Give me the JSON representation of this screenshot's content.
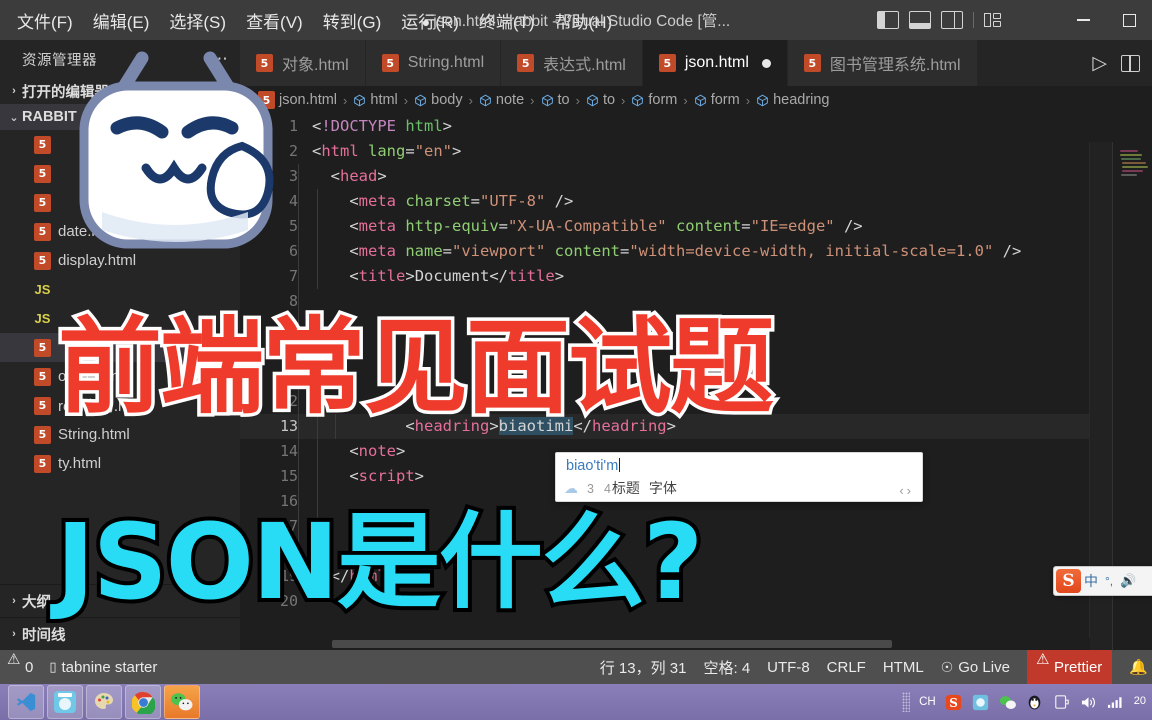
{
  "window": {
    "title": "json.html - rabbit - Visual Studio Code [管...",
    "dirty_dot": "●",
    "menu": [
      "文件(F)",
      "编辑(E)",
      "选择(S)",
      "查看(V)",
      "转到(G)",
      "运行(R)",
      "终端(T)",
      "帮助(H)"
    ],
    "controls": {
      "minimize": "—",
      "maximize": "▢"
    }
  },
  "sidebar": {
    "title": "资源管理器",
    "overflow": "⋯",
    "sections": [
      {
        "label": "打开的编辑器",
        "chevron": "›"
      },
      {
        "label": "RABBIT",
        "chevron": "⌄"
      }
    ],
    "files": [
      {
        "name": "",
        "icon": "html5-icon"
      },
      {
        "name": "",
        "icon": "html5-icon"
      },
      {
        "name": "",
        "icon": "html5-icon"
      },
      {
        "name": "date.html",
        "icon": "html5-icon"
      },
      {
        "name": "display.html",
        "icon": "html5-icon"
      },
      {
        "name": "",
        "icon": "js-icon"
      },
      {
        "name": "",
        "icon": "js-icon"
      },
      {
        "name": "",
        "icon": "html5-icon"
      },
      {
        "name": "oject.html",
        "icon": "html5-icon"
      },
      {
        "name": "rem布局.html",
        "icon": "html5-icon"
      },
      {
        "name": "String.html",
        "icon": "html5-icon"
      },
      {
        "name": "ty.html",
        "icon": "html5-icon"
      }
    ],
    "bottom": [
      {
        "label": "大纲",
        "chevron": "›"
      },
      {
        "label": "时间线",
        "chevron": "›"
      }
    ]
  },
  "tabs": [
    {
      "label": "对象.html",
      "icon": "html5-icon",
      "active": false,
      "dirty": false
    },
    {
      "label": "String.html",
      "icon": "html5-icon",
      "active": false,
      "dirty": false
    },
    {
      "label": "表达式.html",
      "icon": "html5-icon",
      "active": false,
      "dirty": false
    },
    {
      "label": "json.html",
      "icon": "html5-icon",
      "active": true,
      "dirty": true
    },
    {
      "label": "图书管理系统.html",
      "icon": "html5-icon",
      "active": false,
      "dirty": false
    }
  ],
  "tab_actions": {
    "run": "▷",
    "split": "split-editor-icon"
  },
  "breadcrumb": [
    "json.html",
    "html",
    "body",
    "note",
    "to",
    "to",
    "form",
    "form",
    "headring"
  ],
  "code": {
    "lines": [
      {
        "num": "1",
        "indent": 0,
        "current": false,
        "tokens": [
          {
            "t": "punc",
            "v": "<"
          },
          {
            "t": "doct",
            "v": "!DOCTYPE "
          },
          {
            "t": "tagn",
            "v": "html"
          },
          {
            "t": "punc",
            "v": ">"
          }
        ]
      },
      {
        "num": "2",
        "indent": 0,
        "current": false,
        "tokens": [
          {
            "t": "punc",
            "v": "<"
          },
          {
            "t": "tag",
            "v": "html"
          },
          {
            "t": "attrn",
            "v": " lang"
          },
          {
            "t": "punc",
            "v": "="
          },
          {
            "t": "str",
            "v": "\"en\""
          },
          {
            "t": "punc",
            "v": ">"
          }
        ]
      },
      {
        "num": "3",
        "indent": 1,
        "current": false,
        "tokens": [
          {
            "t": "punc",
            "v": "  <"
          },
          {
            "t": "tag",
            "v": "head"
          },
          {
            "t": "punc",
            "v": ">"
          }
        ]
      },
      {
        "num": "4",
        "indent": 2,
        "current": false,
        "tokens": [
          {
            "t": "punc",
            "v": "    <"
          },
          {
            "t": "tag",
            "v": "meta"
          },
          {
            "t": "attrn",
            "v": " charset"
          },
          {
            "t": "punc",
            "v": "="
          },
          {
            "t": "str",
            "v": "\"UTF-8\""
          },
          {
            "t": "punc",
            "v": " />"
          }
        ]
      },
      {
        "num": "5",
        "indent": 2,
        "current": false,
        "tokens": [
          {
            "t": "punc",
            "v": "    <"
          },
          {
            "t": "tag",
            "v": "meta"
          },
          {
            "t": "attrn",
            "v": " http-equiv"
          },
          {
            "t": "punc",
            "v": "="
          },
          {
            "t": "str",
            "v": "\"X-UA-Compatible\""
          },
          {
            "t": "attrn",
            "v": " content"
          },
          {
            "t": "punc",
            "v": "="
          },
          {
            "t": "str",
            "v": "\"IE=edge\""
          },
          {
            "t": "punc",
            "v": " />"
          }
        ]
      },
      {
        "num": "6",
        "indent": 2,
        "current": false,
        "tokens": [
          {
            "t": "punc",
            "v": "    <"
          },
          {
            "t": "tag",
            "v": "meta"
          },
          {
            "t": "attrn",
            "v": " name"
          },
          {
            "t": "punc",
            "v": "="
          },
          {
            "t": "str",
            "v": "\"viewport\""
          },
          {
            "t": "attrn",
            "v": " content"
          },
          {
            "t": "punc",
            "v": "="
          },
          {
            "t": "str",
            "v": "\"width=device-width, initial-scale=1.0\""
          },
          {
            "t": "punc",
            "v": " />"
          }
        ]
      },
      {
        "num": "7",
        "indent": 2,
        "current": false,
        "tokens": [
          {
            "t": "punc",
            "v": "    <"
          },
          {
            "t": "tag",
            "v": "title"
          },
          {
            "t": "punc",
            "v": ">"
          },
          {
            "t": "txt",
            "v": "Document"
          },
          {
            "t": "punc",
            "v": "</"
          },
          {
            "t": "tag",
            "v": "title"
          },
          {
            "t": "punc",
            "v": ">"
          }
        ]
      },
      {
        "num": "8",
        "indent": 1,
        "current": false,
        "tokens": []
      },
      {
        "num": "9",
        "indent": 1,
        "current": false,
        "tokens": []
      },
      {
        "num": "10",
        "indent": 1,
        "current": false,
        "tokens": []
      },
      {
        "num": "11",
        "indent": 1,
        "current": false,
        "tokens": []
      },
      {
        "num": "12",
        "indent": 2,
        "current": false,
        "tokens": []
      },
      {
        "num": "13",
        "indent": 3,
        "current": true,
        "tokens": [
          {
            "t": "punc",
            "v": "          <"
          },
          {
            "t": "tag",
            "v": "headring"
          },
          {
            "t": "punc",
            "v": ">"
          },
          {
            "t": "sel",
            "v": "biaotimi"
          },
          {
            "t": "punc",
            "v": "</"
          },
          {
            "t": "tag",
            "v": "headring"
          },
          {
            "t": "punc",
            "v": ">"
          }
        ]
      },
      {
        "num": "14",
        "indent": 2,
        "current": false,
        "tokens": [
          {
            "t": "punc",
            "v": "    <"
          },
          {
            "t": "tag",
            "v": "note"
          },
          {
            "t": "punc",
            "v": ">"
          }
        ]
      },
      {
        "num": "15",
        "indent": 2,
        "current": false,
        "tokens": [
          {
            "t": "punc",
            "v": "    <"
          },
          {
            "t": "tag",
            "v": "script"
          },
          {
            "t": "punc",
            "v": ">"
          }
        ]
      },
      {
        "num": "16",
        "indent": 2,
        "current": false,
        "tokens": []
      },
      {
        "num": "17",
        "indent": 2,
        "current": false,
        "tokens": []
      },
      {
        "num": "18",
        "indent": 1,
        "current": false,
        "tokens": []
      },
      {
        "num": "19",
        "indent": 0,
        "current": false,
        "tokens": [
          {
            "t": "punc",
            "v": "  </"
          },
          {
            "t": "tag",
            "v": "html"
          },
          {
            "t": "punc",
            "v": ">"
          }
        ]
      },
      {
        "num": "20",
        "indent": 0,
        "current": false,
        "tokens": []
      }
    ]
  },
  "ime": {
    "composition": "biao'ti'm",
    "candidates": [
      {
        "num": "3",
        "word": ""
      },
      {
        "num": "4",
        "word": "标题"
      },
      {
        "num": "",
        "word": "字体"
      }
    ],
    "cloud_icon": "cloud-icon",
    "prev": "‹",
    "next": "›"
  },
  "sogou_bar": {
    "logo": "S",
    "mode": "中",
    "punctuation": "°,",
    "mic": "🎤"
  },
  "statusbar": {
    "left": [
      {
        "icon": "warning-icon",
        "label": "0"
      },
      {
        "icon": "tabnine-icon",
        "label": "tabnine starter"
      }
    ],
    "right": [
      {
        "label": "行 13，列 31"
      },
      {
        "label": "空格: 4"
      },
      {
        "label": "UTF-8"
      },
      {
        "label": "CRLF"
      },
      {
        "label": "HTML"
      },
      {
        "label": "Go Live",
        "icon": "broadcast-icon"
      },
      {
        "label": "Prettier",
        "icon": "warning-icon",
        "highlight": "#c1392b"
      }
    ]
  },
  "taskbar": {
    "items": [
      {
        "name": "vscode-taskbar-icon"
      },
      {
        "name": "live-app-taskbar-icon"
      },
      {
        "name": "paint-taskbar-icon"
      },
      {
        "name": "chrome-taskbar-icon"
      },
      {
        "name": "wechat-taskbar-icon"
      }
    ],
    "tray": [
      {
        "name": "ime-lang-indicator",
        "label": "CH"
      },
      {
        "name": "sogou-tray-icon",
        "label": "S"
      },
      {
        "name": "blue-app-tray-icon",
        "label": ""
      },
      {
        "name": "wechat-tray-icon",
        "label": ""
      },
      {
        "name": "qq-tray-icon",
        "label": ""
      },
      {
        "name": "network-tray-icon",
        "label": ""
      },
      {
        "name": "volume-tray-icon",
        "label": ""
      },
      {
        "name": "signal-tray-icon",
        "label": ""
      }
    ],
    "clock": "20"
  },
  "overlays": {
    "headline_red": "前端常见面试题",
    "headline_cyan": "JSON是什么?",
    "mascot": "bilibili-mascot"
  },
  "colors": {
    "accent_red": "#ef3b2c",
    "accent_cyan": "#28dcf5",
    "status_error": "#c1392b",
    "editor_bg": "#1e1e1e",
    "sidebar_bg": "#252526"
  }
}
